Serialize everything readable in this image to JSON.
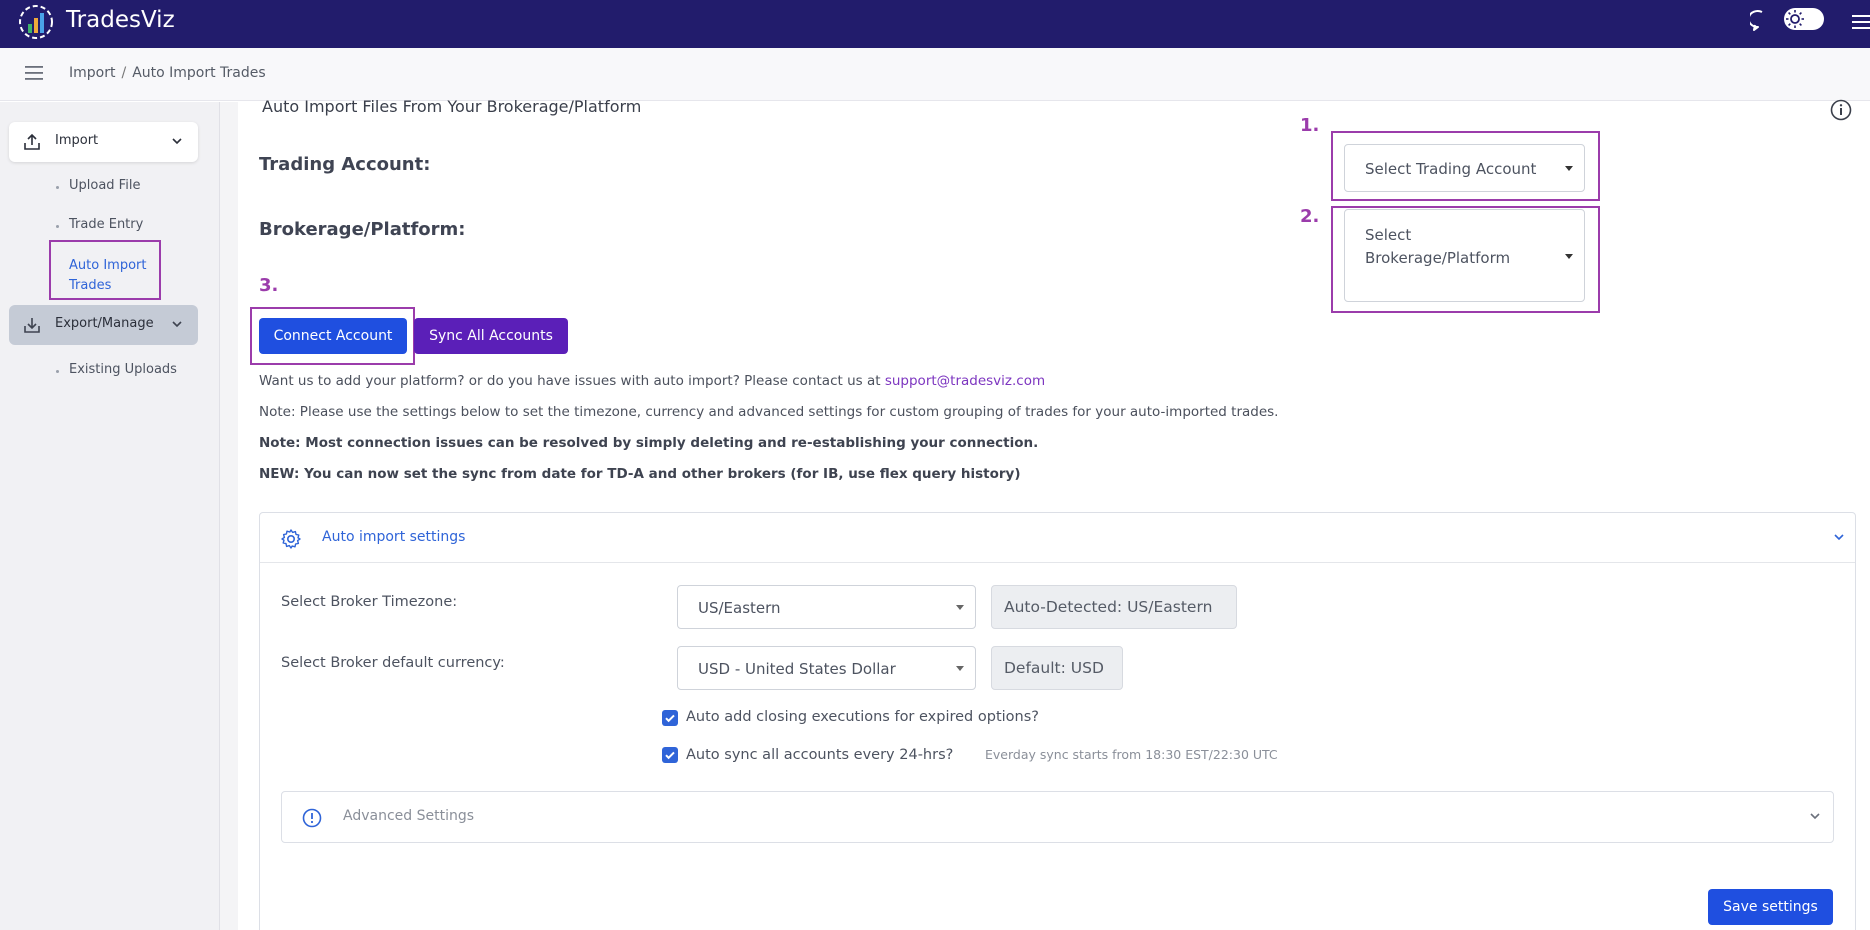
{
  "app": {
    "title": "TradesViz"
  },
  "breadcrumb": {
    "parent": "Import",
    "current": "Auto Import Trades"
  },
  "sidebar": {
    "import_label": "Import",
    "import_items": [
      "Upload File",
      "Trade Entry"
    ],
    "active_item": "Auto Import Trades",
    "export_label": "Export/Manage",
    "export_items": [
      "Existing Uploads"
    ]
  },
  "main": {
    "heading": "Auto Import Files From Your Brokerage/Platform",
    "trading_account_label": "Trading Account:",
    "brokerage_label": "Brokerage/Platform:",
    "markers": [
      "1.",
      "2.",
      "3."
    ],
    "trading_account_select": "Select Trading Account",
    "brokerage_select_line1": "Select",
    "brokerage_select_line2": "Brokerage/Platform",
    "connect_button": "Connect Account",
    "sync_button": "Sync All Accounts",
    "note1_prefix": "Want us to add your platform? or do you have issues with auto import? Please contact us at",
    "support_email": "support@tradesviz.com",
    "note2": "Note: Please use the settings below to set the timezone, currency and advanced settings for custom grouping of trades for your auto-imported trades.",
    "note3": "Note: Most connection issues can be resolved by simply deleting and re-establishing your connection.",
    "note4": "NEW: You can now set the sync from date for TD-A and other brokers (for IB, use flex query history)"
  },
  "settings": {
    "panel_title": "Auto import settings",
    "timezone_label": "Select Broker Timezone:",
    "timezone_value": "US/Eastern",
    "timezone_detected": "Auto-Detected: US/Eastern",
    "currency_label": "Select Broker default currency:",
    "currency_value": "USD - United States Dollar",
    "currency_default": "Default: USD",
    "check1_label": "Auto add closing executions for expired options?",
    "check1_checked": true,
    "check2_label": "Auto sync all accounts every 24-hrs?",
    "check2_checked": true,
    "sync_hint": "Everday sync starts from 18:30 EST/22:30 UTC",
    "advanced_label": "Advanced Settings",
    "save_button": "Save settings"
  },
  "colors": {
    "topbar": "#221c6c",
    "primary": "#1f4fe0",
    "secondary": "#5b1fb8",
    "highlight": "#9b3cab",
    "link": "#2f64d8"
  }
}
